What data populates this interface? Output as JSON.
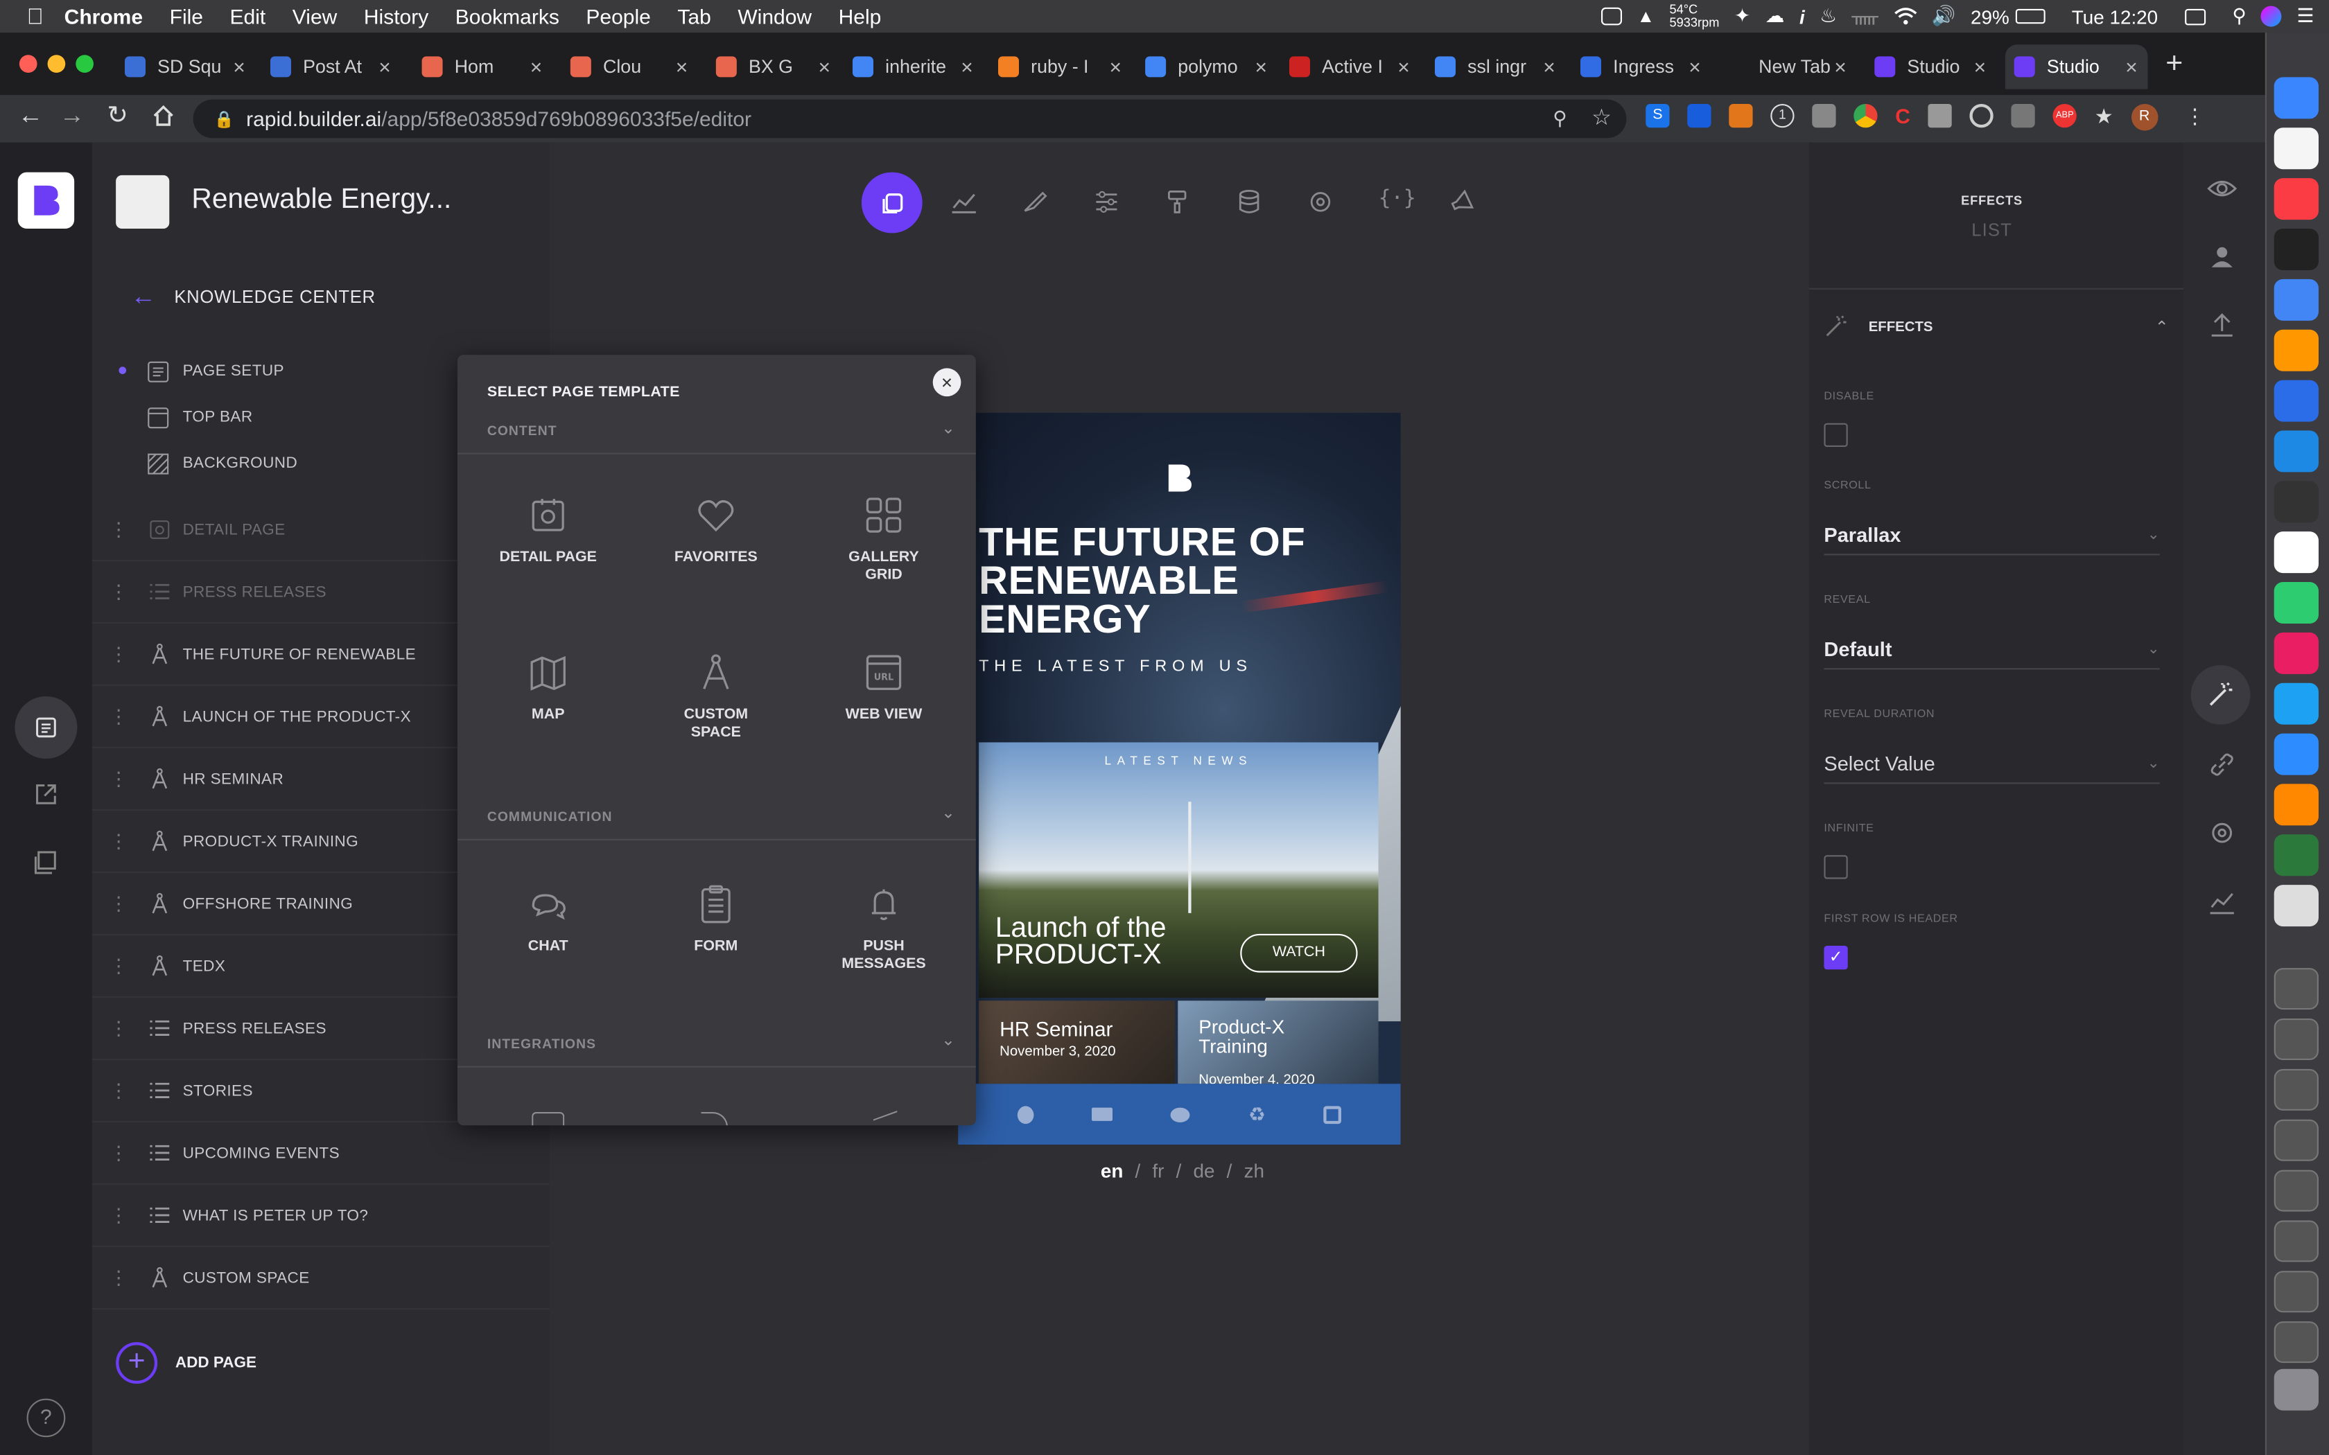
{
  "menubar": {
    "app": "Chrome",
    "items": [
      "File",
      "Edit",
      "View",
      "History",
      "Bookmarks",
      "People",
      "Tab",
      "Window",
      "Help"
    ],
    "temp": "54°C",
    "rpm": "5933rpm",
    "battery": "29%",
    "clock": "Tue 12:20"
  },
  "tabs": [
    {
      "label": "SD Squ",
      "color": "#3b6fd6"
    },
    {
      "label": "Post At",
      "color": "#3b6fd6"
    },
    {
      "label": "Hom",
      "color": "#e8664d"
    },
    {
      "label": "Clou",
      "color": "#e8664d"
    },
    {
      "label": "BX G",
      "color": "#e8664d"
    },
    {
      "label": "inherite",
      "color": "#4285f4"
    },
    {
      "label": "ruby - I",
      "color": "#f48024"
    },
    {
      "label": "polymo",
      "color": "#4285f4"
    },
    {
      "label": "Active I",
      "color": "#cc2222"
    },
    {
      "label": "ssl ingr",
      "color": "#4285f4"
    },
    {
      "label": "Ingress",
      "color": "#326ce5"
    },
    {
      "label": "New Tab",
      "color": "#1e1e20"
    },
    {
      "label": "Studio",
      "color": "#6c3df4"
    },
    {
      "label": "Studio",
      "color": "#6c3df4"
    }
  ],
  "address": {
    "host": "rapid.builder.ai",
    "path": "/app/5f8e03859d769b0896033f5e/editor"
  },
  "project": {
    "title": "Renewable Energy..."
  },
  "sidebar": {
    "back_label": "KNOWLEDGE CENTER",
    "setup_items": [
      "PAGE SETUP",
      "TOP BAR",
      "BACKGROUND"
    ],
    "pages": [
      {
        "label": "DETAIL PAGE",
        "icon": "detail",
        "dim": true
      },
      {
        "label": "PRESS RELEASES",
        "icon": "list",
        "dim": true
      },
      {
        "label": "THE FUTURE OF RENEWABLE",
        "icon": "compass",
        "dim": false
      },
      {
        "label": "LAUNCH OF THE PRODUCT-X",
        "icon": "compass",
        "dim": false
      },
      {
        "label": "HR SEMINAR",
        "icon": "compass",
        "dim": false
      },
      {
        "label": "PRODUCT-X TRAINING",
        "icon": "compass",
        "dim": false
      },
      {
        "label": "OFFSHORE TRAINING",
        "icon": "compass",
        "dim": false
      },
      {
        "label": "TEDX",
        "icon": "compass",
        "dim": false
      },
      {
        "label": "PRESS RELEASES",
        "icon": "list",
        "dim": false
      },
      {
        "label": "STORIES",
        "icon": "list",
        "dim": false
      },
      {
        "label": "UPCOMING EVENTS",
        "icon": "list",
        "dim": false
      },
      {
        "label": "WHAT IS PETER UP TO?",
        "icon": "list",
        "dim": false
      },
      {
        "label": "CUSTOM SPACE",
        "icon": "compass",
        "dim": false
      }
    ],
    "add_page": "ADD PAGE"
  },
  "modal": {
    "title": "SELECT PAGE TEMPLATE",
    "sections": [
      {
        "name": "CONTENT",
        "tiles": [
          {
            "label": "DETAIL PAGE",
            "icon": "detail-page-icon"
          },
          {
            "label": "FAVORITES",
            "icon": "heart-icon"
          },
          {
            "label": "GALLERY GRID",
            "icon": "grid-icon"
          },
          {
            "label": "MAP",
            "icon": "map-icon"
          },
          {
            "label": "CUSTOM SPACE",
            "icon": "compass-icon"
          },
          {
            "label": "WEB VIEW",
            "icon": "web-view-icon"
          }
        ]
      },
      {
        "name": "COMMUNICATION",
        "tiles": [
          {
            "label": "CHAT",
            "icon": "chat-icon"
          },
          {
            "label": "FORM",
            "icon": "clipboard-icon"
          },
          {
            "label": "PUSH MESSAGES",
            "icon": "bell-icon"
          }
        ]
      },
      {
        "name": "INTEGRATIONS",
        "tiles": []
      }
    ]
  },
  "preview": {
    "hero_title": "THE FUTURE OF RENEWABLE ENERGY",
    "hero_sub": "THE LATEST FROM US",
    "news_label": "LATEST NEWS",
    "card_title": "Launch of the PRODUCT-X",
    "watch": "WATCH",
    "small1_title": "HR Seminar",
    "small1_date": "November 3, 2020",
    "small2_title": "Product-X Training",
    "small2_date": "November 4, 2020"
  },
  "languages": [
    "en",
    "fr",
    "de",
    "zh"
  ],
  "right_panel": {
    "header_title": "EFFECTS",
    "header_sub": "LIST",
    "section": "EFFECTS",
    "disable_label": "DISABLE",
    "scroll_label": "SCROLL",
    "scroll_value": "Parallax",
    "reveal_label": "REVEAL",
    "reveal_value": "Default",
    "duration_label": "REVEAL DURATION",
    "duration_value": "Select Value",
    "infinite_label": "INFINITE",
    "header_row_label": "FIRST ROW IS HEADER",
    "accent": "#6c3df4"
  }
}
